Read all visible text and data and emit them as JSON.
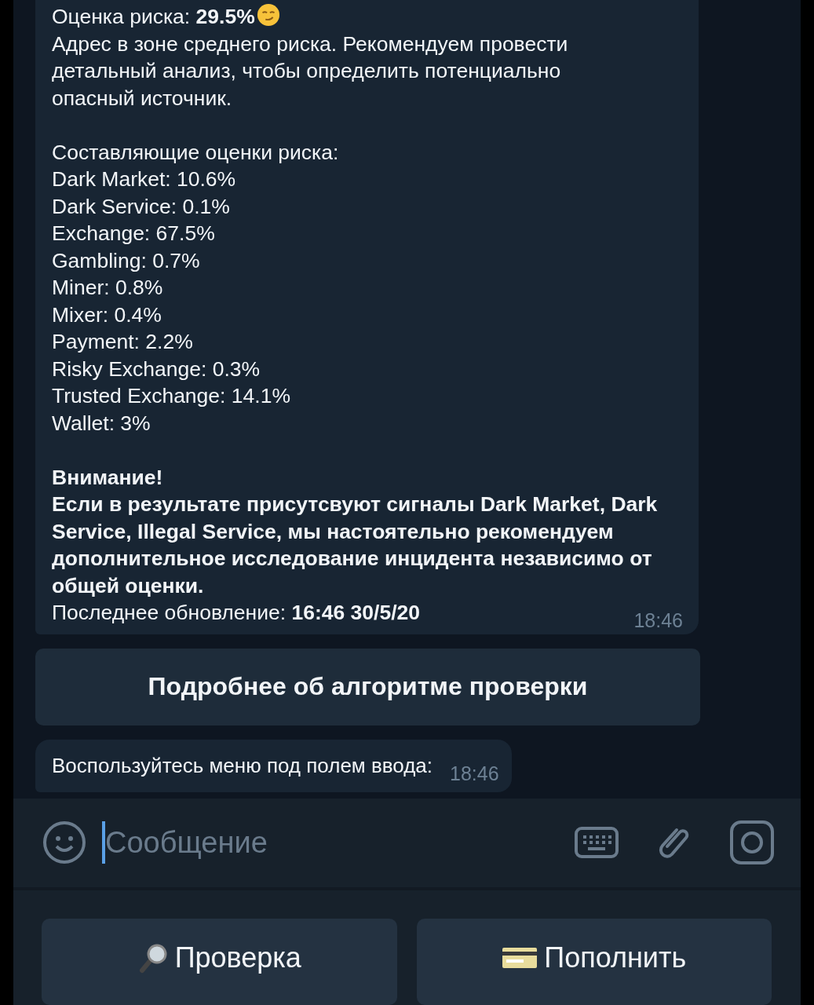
{
  "report": {
    "score_line": "Оценка риска: **29.5%**",
    "summary": "Адрес в зоне среднего риска. Рекомендуем провести детальный анализ, чтобы определить потенциально опасный источник.",
    "components_title": "Составляющие оценки риска:",
    "components": [
      "Dark Market: 10.6%",
      "Dark Service: 0.1%",
      "Exchange: 67.5%",
      "Gambling: 0.7%",
      "Miner: 0.8%",
      "Mixer: 0.4%",
      "Payment: 2.2%",
      "Risky Exchange: 0.3%",
      "Trusted Exchange: 14.1%",
      "Wallet: 3%"
    ],
    "warning_title": "Внимание!",
    "warning": "Если в результате присутсвуют сигналы Dark Market, Dark Service, Illegal Service, мы настоятельно рекомендуем дополнительное исследование инцидента независимо от общей оценки.",
    "updated": "Последнее обновление: **16:46 30/5/20**",
    "time": "18:46"
  },
  "inline_button": "Подробнее об алгоритме проверки",
  "notice": {
    "text": "Воспользуйтесь меню под полем ввода:",
    "time": "18:46"
  },
  "composer": {
    "placeholder": "Сообщение"
  },
  "keyboard": [
    {
      "label": "Проверка",
      "kind": "check"
    },
    {
      "label": "Пополнить",
      "kind": "topup"
    }
  ]
}
